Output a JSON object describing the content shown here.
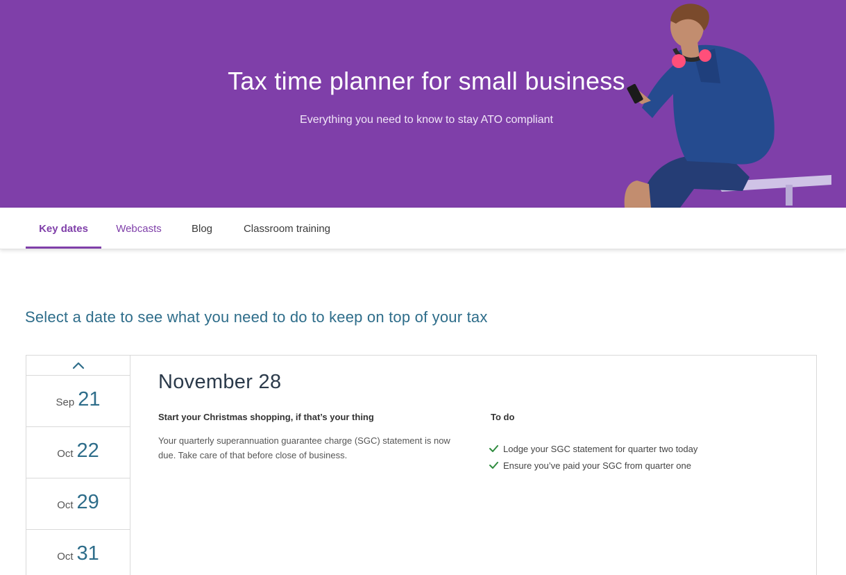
{
  "hero": {
    "title": "Tax time planner for small business",
    "subtitle": "Everything you need to know to stay ATO compliant"
  },
  "tabs": [
    {
      "label": "Key dates",
      "active": true
    },
    {
      "label": "Webcasts",
      "active": false
    },
    {
      "label": "Blog",
      "active": false
    },
    {
      "label": "Classroom training",
      "active": false
    }
  ],
  "section_heading": "Select a date to see what you need to do to keep on top of your tax",
  "dates": [
    {
      "month": "Sep",
      "day": "21"
    },
    {
      "month": "Oct",
      "day": "22"
    },
    {
      "month": "Oct",
      "day": "29"
    },
    {
      "month": "Oct",
      "day": "31"
    }
  ],
  "detail": {
    "date": "November 28",
    "subheading": "Start your Christmas shopping, if that’s your thing",
    "body": "Your quarterly superannuation guarantee charge (SGC) statement is now due. Take care of that before close of business.",
    "todo_label": "To do",
    "todos": [
      "Lodge your SGC statement for quarter two today",
      "Ensure you’ve paid your SGC from quarter one"
    ]
  },
  "colors": {
    "brand_purple": "#7f3fa9",
    "heading_blue": "#2e6d8a",
    "check_green": "#2e8b3e"
  },
  "icons": {
    "scroll_up": "chevron-up-icon",
    "todo_check": "checkmark-icon"
  }
}
